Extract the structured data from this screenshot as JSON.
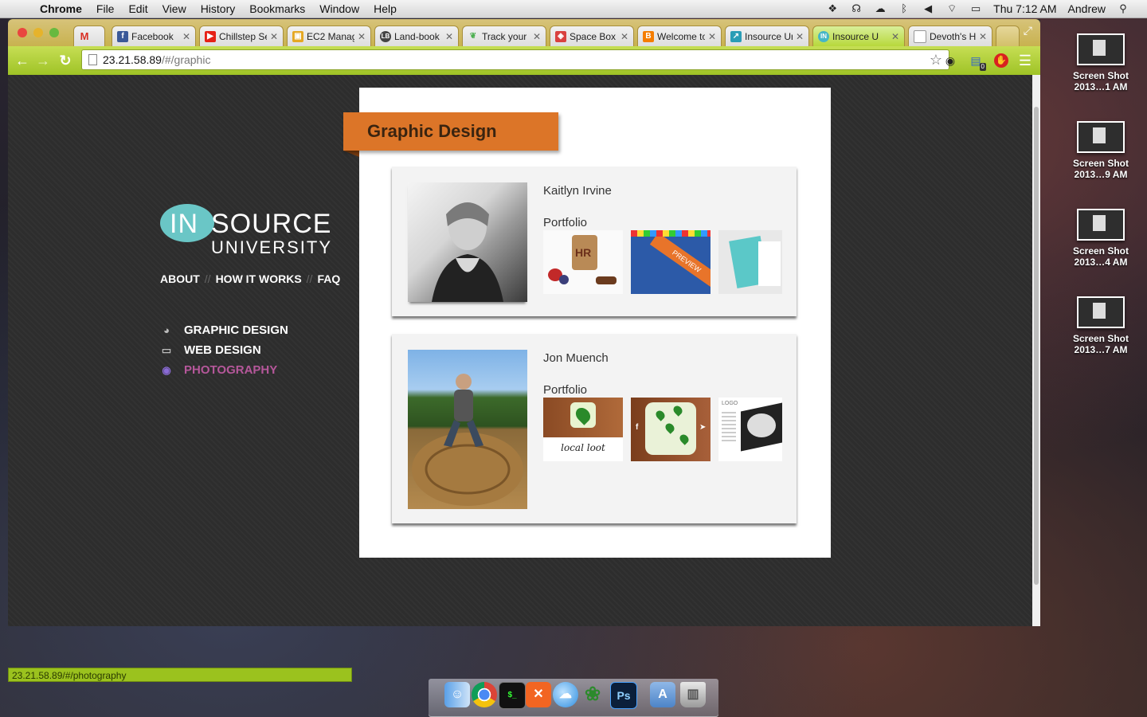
{
  "menubar": {
    "app_name": "Chrome",
    "menus": [
      "File",
      "Edit",
      "View",
      "History",
      "Bookmarks",
      "Window",
      "Help"
    ],
    "clock": "Thu 7:12 AM",
    "user": "Andrew"
  },
  "desktop": {
    "icons": [
      {
        "line1": "Screen Shot",
        "line2": "2013…1 AM"
      },
      {
        "line1": "Screen Shot",
        "line2": "2013…9 AM"
      },
      {
        "line1": "Screen Shot",
        "line2": "2013…4 AM"
      },
      {
        "line1": "Screen Shot",
        "line2": "2013…7 AM"
      }
    ]
  },
  "browser": {
    "tabs": [
      {
        "label": "",
        "icon": "gmail-icon",
        "color": "#d93025"
      },
      {
        "label": "Facebook",
        "icon": "facebook-icon",
        "color": "#3b5998"
      },
      {
        "label": "Chillstep Se",
        "icon": "youtube-icon",
        "color": "#e62117"
      },
      {
        "label": "EC2 Manag",
        "icon": "aws-icon",
        "color": "#e5a823"
      },
      {
        "label": "Land-book",
        "icon": "landbook-icon",
        "color": "#444444"
      },
      {
        "label": "Track your",
        "icon": "leaf-icon",
        "color": "#4caf50"
      },
      {
        "label": "Space Box",
        "icon": "spacebox-icon",
        "color": "#d9413f"
      },
      {
        "label": "Welcome to",
        "icon": "blogger-icon",
        "color": "#f57d00"
      },
      {
        "label": "Insource Un",
        "icon": "insource-icon",
        "color": "#2a9db6"
      },
      {
        "label": "Insource U",
        "icon": "insource-icon",
        "color": "#46b6c6"
      },
      {
        "label": "Devoth's HT",
        "icon": "page-icon",
        "color": "#999999"
      }
    ],
    "active_tab_index": 9,
    "url_host": "23.21.58.89",
    "url_path": "/#/graphic",
    "status_text": "23.21.58.89/#/photography",
    "extension_badge": "0"
  },
  "site": {
    "logo_in": "IN",
    "logo_source": "SOURCE",
    "logo_university": "UNIVERSITY",
    "top_nav": [
      "ABOUT",
      "HOW IT WORKS",
      "FAQ"
    ],
    "side_nav": [
      {
        "label": "GRAPHIC DESIGN",
        "icon": "palette-icon"
      },
      {
        "label": "WEB DESIGN",
        "icon": "browser-window-icon"
      },
      {
        "label": "PHOTOGRAPHY",
        "icon": "camera-lens-icon"
      }
    ],
    "section_title": "Graphic Design",
    "students": [
      {
        "name": "Kaitlyn Irvine",
        "portfolio_label": "Portfolio",
        "thumbs": [
          "HR",
          "PREVIEW",
          ""
        ]
      },
      {
        "name": "Jon Muench",
        "portfolio_label": "Portfolio",
        "thumbs": [
          "local loot",
          "",
          "LOGO"
        ]
      }
    ]
  },
  "colors": {
    "accent_orange": "#dc7528",
    "accent_teal": "#6ac6c6",
    "hover_pink": "#b5579a",
    "chrome_green": "#9fc326"
  }
}
